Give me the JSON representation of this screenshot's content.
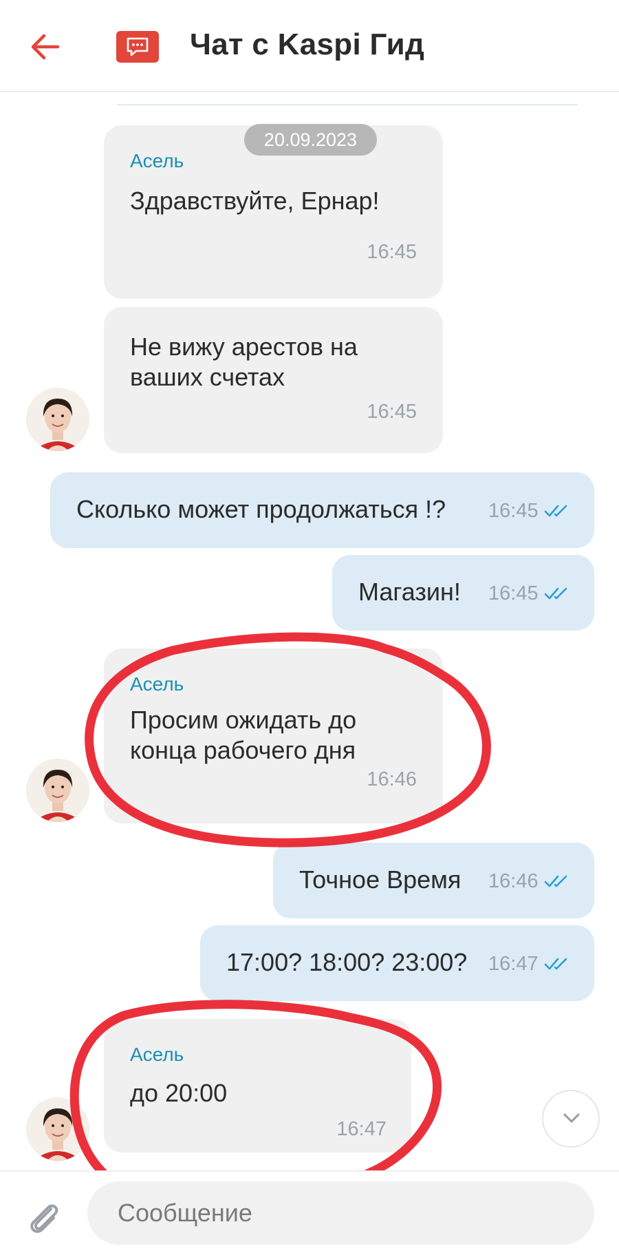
{
  "header": {
    "title": "Чат с Kaspi Гид",
    "back_icon": "arrow-left-icon",
    "chat_icon": "chat-bubble-icon",
    "accent_color": "#e2453a"
  },
  "date_chip": "20.09.2023",
  "messages": [
    {
      "direction": "in",
      "sender": "Асель",
      "text": "Здравствуйте, Ернар!",
      "time": "16:45"
    },
    {
      "direction": "in",
      "sender": "",
      "lines": [
        "Не вижу арестов на",
        "ваших счетах"
      ],
      "time": "16:45"
    },
    {
      "direction": "out",
      "text": "Сколько может продолжаться !?",
      "time": "16:45",
      "status": "read"
    },
    {
      "direction": "out",
      "text": "Магазин!",
      "time": "16:45",
      "status": "read"
    },
    {
      "direction": "in",
      "sender": "Асель",
      "lines": [
        "Просим ожидать до",
        "конца рабочего дня"
      ],
      "time": "16:46"
    },
    {
      "direction": "out",
      "text": "Точное Время",
      "time": "16:46",
      "status": "read"
    },
    {
      "direction": "out",
      "text": "17:00? 18:00? 23:00?",
      "time": "16:47",
      "status": "read"
    },
    {
      "direction": "in",
      "sender": "Асель",
      "text": "до 20:00",
      "time": "16:47"
    }
  ],
  "colors": {
    "incoming_bubble": "#f0f0f0",
    "outgoing_bubble": "#dcebf5",
    "sender_name": "#1a8fb5",
    "read_ticks": "#2a9fd0",
    "annotation": "#e8202a"
  },
  "composer": {
    "placeholder": "Сообщение",
    "attach_icon": "paperclip-icon"
  },
  "scroll_button_icon": "chevron-down-icon"
}
